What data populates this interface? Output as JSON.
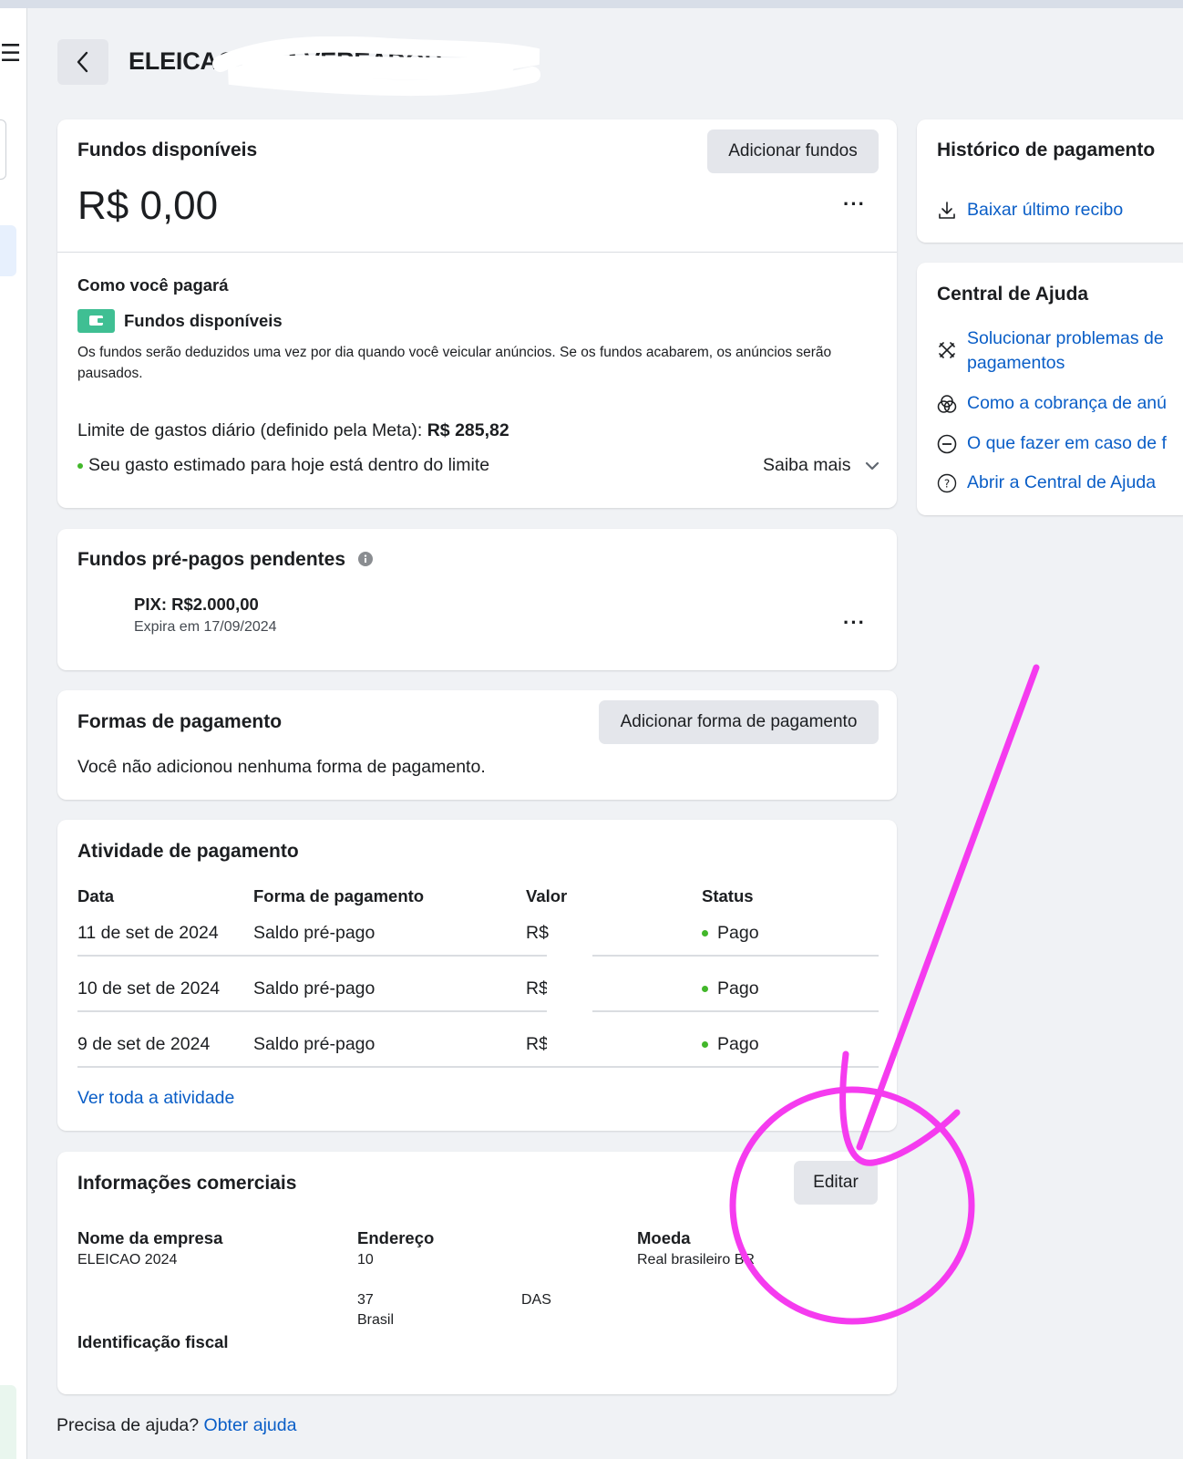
{
  "header": {
    "title": "ELEICAO 2024 VEREADOR"
  },
  "funds": {
    "title": "Fundos disponíveis",
    "add_button": "Adicionar fundos",
    "amount": "R$ 0,00",
    "more": "···",
    "how_title": "Como você pagará",
    "method": "Fundos disponíveis",
    "description_line1": "Os fundos serão deduzidos uma vez por dia quando você veicular anúncios. Se os fundos acabarem, os anúncios serão",
    "description_line2": "pausados.",
    "limit_label": "Limite de gastos diário (definido pela Meta):",
    "limit_value": "R$ 285,82",
    "status": "Seu gasto estimado para hoje está dentro do limite",
    "learn_more": "Saiba mais"
  },
  "pending": {
    "title": "Fundos pré-pagos pendentes",
    "pix": "PIX: R$2.000,00",
    "expires": "Expira em 17/09/2024",
    "more": "···"
  },
  "methods": {
    "title": "Formas de pagamento",
    "add_button": "Adicionar forma de pagamento",
    "empty": "Você não adicionou nenhuma forma de pagamento."
  },
  "activity": {
    "title": "Atividade de pagamento",
    "columns": [
      "Data",
      "Forma de pagamento",
      "Valor",
      "Status"
    ],
    "rows": [
      {
        "date": "11 de set de 2024",
        "method": "Saldo pré-pago",
        "value": "R$",
        "status": "Pago"
      },
      {
        "date": "10 de set de 2024",
        "method": "Saldo pré-pago",
        "value": "R$",
        "status": "Pago"
      },
      {
        "date": "9 de set de 2024",
        "method": "Saldo pré-pago",
        "value": "R$",
        "status": "Pago"
      }
    ],
    "see_all": "Ver toda a atividade"
  },
  "business": {
    "title": "Informações comerciais",
    "edit_button": "Editar",
    "company_label": "Nome da empresa",
    "company_value": "ELEICAO 2024",
    "address_label": "Endereço",
    "address_line1": "10",
    "address_line3": "37",
    "address_line3b": "DAS",
    "address_line4": "Brasil",
    "currency_label": "Moeda",
    "currency_value": "Real brasileiro BR",
    "tax_label": "Identificação fiscal"
  },
  "footer": {
    "question": "Precisa de ajuda?",
    "link": "Obter ajuda"
  },
  "sidebar": {
    "history_title": "Histórico de pagamento",
    "download_receipt": "Baixar último recibo",
    "help_title": "Central de Ajuda",
    "help_items": [
      {
        "line1": "Solucionar problemas de",
        "line2": "pagamentos",
        "icon": "wrench-icon"
      },
      {
        "line1": "Como a cobrança de anú",
        "icon": "venn-icon"
      },
      {
        "line1": "O que fazer em caso de f",
        "icon": "minus-circle-icon"
      },
      {
        "line1": "Abrir a Central de Ajuda",
        "icon": "question-circle-icon"
      }
    ]
  },
  "colors": {
    "link": "#0a5ec7",
    "status_green": "#42b72a",
    "annotation": "#f53bef",
    "wallet": "#3fbf93"
  }
}
